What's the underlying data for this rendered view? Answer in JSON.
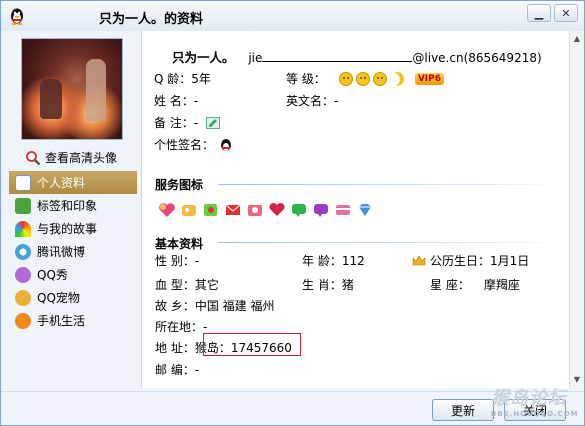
{
  "window": {
    "title": "只为一人。的资料"
  },
  "sidebar": {
    "view_hd_avatar": "查看高清头像",
    "items": [
      {
        "label": "个人资料",
        "icon": "profile-card-icon",
        "active": true
      },
      {
        "label": "标签和印象",
        "icon": "tag-icon",
        "active": false
      },
      {
        "label": "与我的故事",
        "icon": "rainbow-icon",
        "active": false
      },
      {
        "label": "腾讯微博",
        "icon": "weibo-icon",
        "active": false
      },
      {
        "label": "QQ秀",
        "icon": "qqshow-icon",
        "active": false
      },
      {
        "label": "QQ宠物",
        "icon": "pet-icon",
        "active": false
      },
      {
        "label": "手机生活",
        "icon": "mobile-life-icon",
        "active": false
      }
    ]
  },
  "profile": {
    "nickname": "只为一人。",
    "email_prefix": "jie",
    "email_suffix": "@live.cn(865649218)",
    "q_age_label": "Q    龄：",
    "q_age_value": "5年",
    "level_label": "等    级：",
    "vip_label": "VIP6",
    "name_label": "姓    名：",
    "name_value": "-",
    "english_name_label": "英文名：",
    "english_name_value": "-",
    "remark_label": "备    注：",
    "remark_value": "-",
    "signature_label": "个性签名："
  },
  "service_section": {
    "title": "服务图标"
  },
  "basic_section": {
    "title": "基本资料",
    "gender_label": "性    别：",
    "gender_value": "-",
    "age_label": "年    龄：",
    "age_value": "112",
    "birthday_label": "公历生日：",
    "birthday_value": "1月1日",
    "blood_label": "血    型：",
    "blood_value": "其它",
    "zodiac_label": "生    肖：",
    "zodiac_value": "猪",
    "star_label": "星    座：",
    "star_value": "摩羯座",
    "hometown_label": "故    乡：",
    "hometown_value": "中国 福建 福州",
    "location_label": "所在地：",
    "location_value": "-",
    "address_label": "地    址：",
    "address_value": "猴岛：17457660",
    "postcode_label": "邮    编：",
    "postcode_value": "-"
  },
  "footer": {
    "refresh_button": "更新",
    "close_button": "关闭",
    "watermark": "猴岛论坛",
    "watermark_url": "BBS.HOUDAO.COM"
  }
}
